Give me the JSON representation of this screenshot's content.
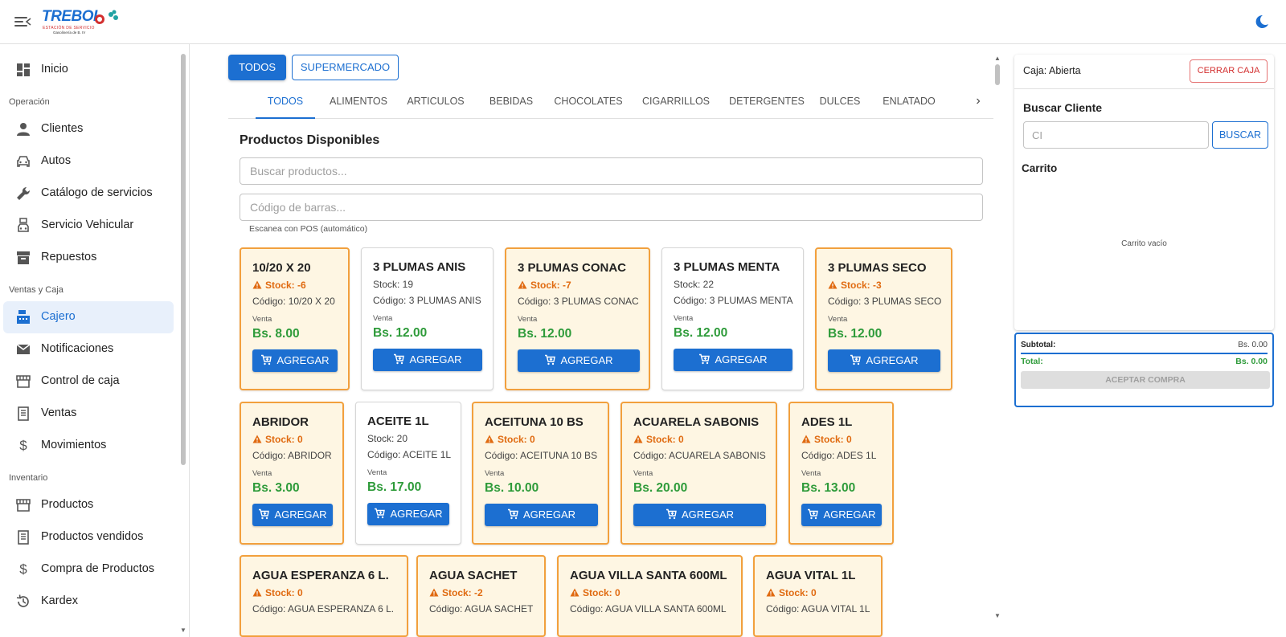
{
  "app": {
    "logo_text": "TREBOL",
    "logo_subtitle": "ESTACIÓN DE SERVICIO",
    "logo_tagline": "Gasolinería de B. IV",
    "menu_icon": "menu-icon",
    "theme_icon": "dark-mode-icon"
  },
  "sidebar": {
    "items_top": [
      {
        "label": "Inicio",
        "icon": "dashboard-icon"
      }
    ],
    "sections": [
      {
        "title": "Operación",
        "items": [
          {
            "label": "Clientes",
            "icon": "person-icon"
          },
          {
            "label": "Autos",
            "icon": "car-icon"
          },
          {
            "label": "Catálogo de servicios",
            "icon": "wrench-icon"
          },
          {
            "label": "Servicio Vehicular",
            "icon": "car-service-icon"
          },
          {
            "label": "Repuestos",
            "icon": "inventory-box-icon"
          }
        ]
      },
      {
        "title": "Ventas y Caja",
        "items": [
          {
            "label": "Cajero",
            "icon": "cash-register-icon",
            "active": true
          },
          {
            "label": "Notificaciones",
            "icon": "mail-icon"
          },
          {
            "label": "Control de caja",
            "icon": "store-icon"
          },
          {
            "label": "Ventas",
            "icon": "receipt-icon"
          },
          {
            "label": "Movimientos",
            "icon": "dollar-icon"
          }
        ]
      },
      {
        "title": "Inventario",
        "items": [
          {
            "label": "Productos",
            "icon": "store-icon"
          },
          {
            "label": "Productos vendidos",
            "icon": "receipt-icon"
          },
          {
            "label": "Compra de Productos",
            "icon": "dollar-icon"
          },
          {
            "label": "Kardex",
            "icon": "history-icon"
          }
        ]
      }
    ]
  },
  "filters": {
    "todos": "TODOS",
    "supermercado": "SUPERMERCADO"
  },
  "tabs": [
    "TODOS",
    "ALIMENTOS",
    "ARTICULOS",
    "BEBIDAS",
    "CHOCOLATES",
    "CIGARRILLOS",
    "DETERGENTES",
    "DULCES",
    "ENLATADO"
  ],
  "products_section": {
    "title": "Productos Disponibles",
    "search_placeholder": "Buscar productos...",
    "barcode_placeholder": "Código de barras...",
    "helper": "Escanea con POS (automático)",
    "venta_label": "Venta",
    "add_label": "AGREGAR"
  },
  "products": [
    {
      "name": "10/20 X 20",
      "stock": "Stock: -6",
      "code": "Código: 10/20 X 20",
      "price": "Bs. 8.00",
      "warn": true
    },
    {
      "name": "3 PLUMAS ANIS",
      "stock": "Stock: 19",
      "code": "Código: 3 PLUMAS ANIS",
      "price": "Bs. 12.00",
      "warn": false
    },
    {
      "name": "3 PLUMAS CONAC",
      "stock": "Stock: -7",
      "code": "Código: 3 PLUMAS CONAC",
      "price": "Bs. 12.00",
      "warn": true
    },
    {
      "name": "3 PLUMAS MENTA",
      "stock": "Stock: 22",
      "code": "Código: 3 PLUMAS MENTA",
      "price": "Bs. 12.00",
      "warn": false
    },
    {
      "name": "3 PLUMAS SECO",
      "stock": "Stock: -3",
      "code": "Código: 3 PLUMAS SECO",
      "price": "Bs. 12.00",
      "warn": true
    },
    {
      "name": "ABRIDOR",
      "stock": "Stock: 0",
      "code": "Código: ABRIDOR",
      "price": "Bs. 3.00",
      "warn": true
    },
    {
      "name": "ACEITE 1L",
      "stock": "Stock: 20",
      "code": "Código: ACEITE 1L",
      "price": "Bs. 17.00",
      "warn": false
    },
    {
      "name": "ACEITUNA 10 BS",
      "stock": "Stock: 0",
      "code": "Código: ACEITUNA 10 BS",
      "price": "Bs. 10.00",
      "warn": true
    },
    {
      "name": "ACUARELA SABONIS",
      "stock": "Stock: 0",
      "code": "Código: ACUARELA SABONIS",
      "price": "Bs. 20.00",
      "warn": true
    },
    {
      "name": "ADES 1L",
      "stock": "Stock: 0",
      "code": "Código: ADES 1L",
      "price": "Bs. 13.00",
      "warn": true
    },
    {
      "name": "AGUA ESPERANZA 6 L.",
      "stock": "Stock: 0",
      "code": "Código: AGUA ESPERANZA 6 L.",
      "price": "",
      "warn": true
    },
    {
      "name": "AGUA SACHET",
      "stock": "Stock: -2",
      "code": "Código: AGUA SACHET",
      "price": "",
      "warn": true
    },
    {
      "name": "AGUA VILLA SANTA 600ML",
      "stock": "Stock: 0",
      "code": "Código: AGUA VILLA SANTA 600ML",
      "price": "",
      "warn": true
    },
    {
      "name": "AGUA VITAL 1L",
      "stock": "Stock: 0",
      "code": "Código: AGUA VITAL 1L",
      "price": "",
      "warn": true
    }
  ],
  "right_panel": {
    "caja_prefix": "Caja:",
    "caja_status": "Abierta",
    "cerrar_label": "CERRAR CAJA",
    "buscar_title": "Buscar Cliente",
    "ci_placeholder": "CI",
    "buscar_label": "BUSCAR",
    "carrito_title": "Carrito",
    "carrito_empty": "Carrito vacío",
    "subtotal_label": "Subtotal:",
    "subtotal_value": "Bs. 0.00",
    "total_label": "Total:",
    "total_value": "Bs. 0.00",
    "aceptar_label": "ACEPTAR COMPRA"
  },
  "colors": {
    "primary": "#1c6fd1",
    "warning_border": "#f2a03d",
    "warning_bg": "#fef6e3",
    "price_green": "#2e9b3a",
    "danger": "#d32f2f"
  }
}
